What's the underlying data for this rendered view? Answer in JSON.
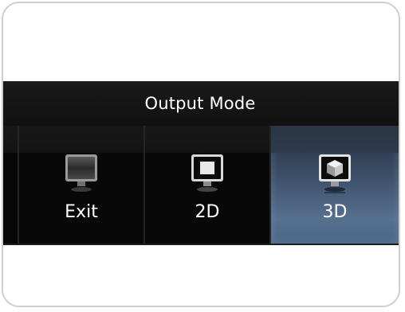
{
  "dialog": {
    "title": "Output Mode",
    "buttons": [
      {
        "label": "Exit",
        "icon": "monitor-blank-icon",
        "selected": false
      },
      {
        "label": "2D",
        "icon": "monitor-2d-icon",
        "selected": false
      },
      {
        "label": "3D",
        "icon": "monitor-3d-cube-icon",
        "selected": true
      }
    ]
  },
  "colors": {
    "panel_background": "#0f0f10",
    "selected_highlight": "#56708f",
    "text": "#ffffff"
  }
}
